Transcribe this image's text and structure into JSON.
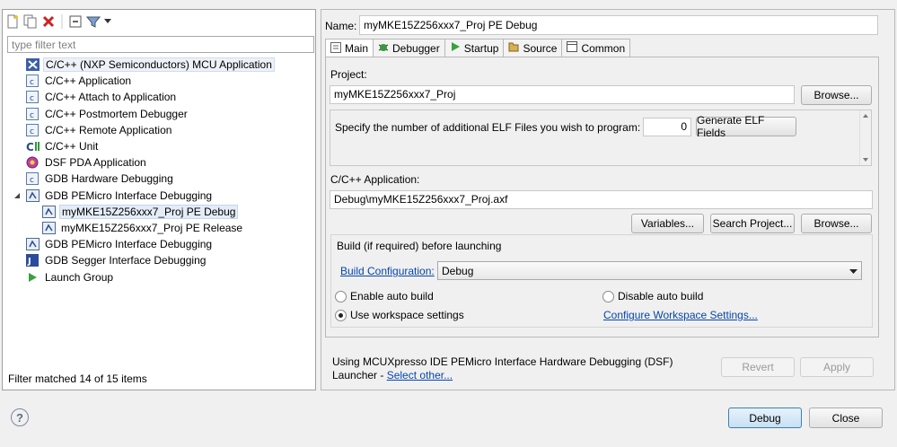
{
  "filter": {
    "placeholder": "type filter text"
  },
  "tree": [
    {
      "label": "C/C++ (NXP Semiconductors) MCU Application",
      "icon": "nxp-icon"
    },
    {
      "label": "C/C++ Application",
      "icon": "c-app-icon"
    },
    {
      "label": "C/C++ Attach to Application",
      "icon": "c-app-icon"
    },
    {
      "label": "C/C++ Postmortem Debugger",
      "icon": "c-app-icon"
    },
    {
      "label": "C/C++ Remote Application",
      "icon": "c-app-icon"
    },
    {
      "label": "C/C++ Unit",
      "icon": "c-unit-icon"
    },
    {
      "label": "DSF PDA Application",
      "icon": "dsf-icon"
    },
    {
      "label": "GDB Hardware Debugging",
      "icon": "c-app-icon"
    },
    {
      "label": "GDB PEMicro Interface Debugging",
      "icon": "pemicro-icon"
    },
    {
      "label": "myMKE15Z256xxx7_Proj PE Debug",
      "icon": "pemicro-icon"
    },
    {
      "label": "myMKE15Z256xxx7_Proj PE Release",
      "icon": "pemicro-icon"
    },
    {
      "label": "GDB PEMicro Interface Debugging",
      "icon": "pemicro-icon"
    },
    {
      "label": "GDB Segger Interface Debugging",
      "icon": "segger-icon"
    },
    {
      "label": "Launch Group",
      "icon": "launch-icon"
    }
  ],
  "filter_status": "Filter matched 14 of 15 items",
  "name": {
    "label": "Name:",
    "value": "myMKE15Z256xxx7_Proj PE Debug"
  },
  "tabs": [
    "Main",
    "Debugger",
    "Startup",
    "Source",
    "Common"
  ],
  "project": {
    "label": "Project:",
    "value": "myMKE15Z256xxx7_Proj",
    "browse": "Browse..."
  },
  "elf": {
    "label": "Specify the number of additional ELF Files you wish to program:",
    "value": "0",
    "button": "Generate ELF Fields"
  },
  "app": {
    "label": "C/C++ Application:",
    "value": "Debug\\myMKE15Z256xxx7_Proj.axf",
    "variables": "Variables...",
    "search": "Search Project...",
    "browse": "Browse..."
  },
  "build": {
    "title": "Build (if required) before launching",
    "config_link": "Build Configuration:",
    "config_value": "Debug",
    "enable_auto": "Enable auto build",
    "disable_auto": "Disable auto build",
    "use_workspace": "Use workspace settings",
    "configure_link": "Configure Workspace Settings..."
  },
  "launcher": {
    "line1": "Using MCUXpresso IDE PEMicro Interface Hardware Debugging (DSF)",
    "line2": "Launcher - ",
    "link": "Select other..."
  },
  "buttons": {
    "revert": "Revert",
    "apply": "Apply",
    "debug": "Debug",
    "close": "Close"
  },
  "help_symbol": "?"
}
